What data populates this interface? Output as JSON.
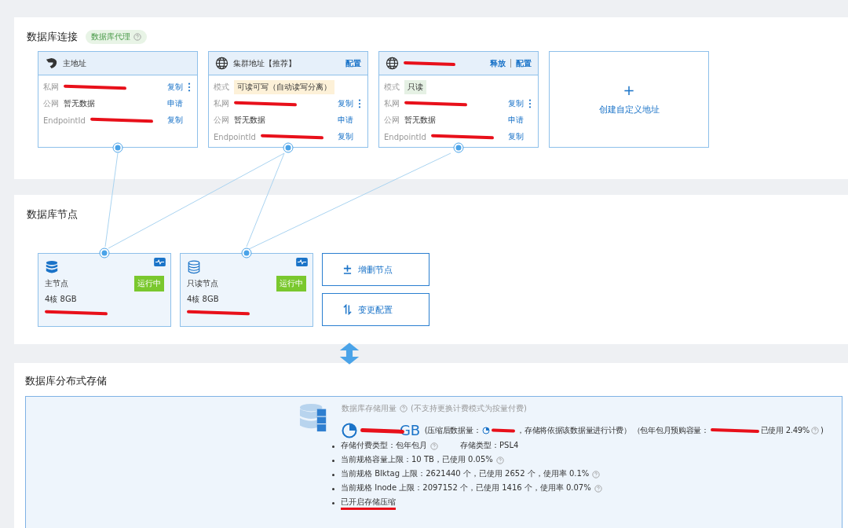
{
  "connection": {
    "title": "数据库连接",
    "tag": "数据库代理",
    "addresses": [
      {
        "kind": "named",
        "title": "主地址",
        "rows": [
          {
            "label": "私网",
            "kind": "redacted",
            "action": "复制",
            "more": true
          },
          {
            "label": "公网",
            "kind": "text",
            "value": "暂无数据",
            "action": "申请",
            "more": false
          },
          {
            "label": "EndpointId",
            "kind": "redacted",
            "action": "复制",
            "more": false
          }
        ]
      },
      {
        "kind": "named",
        "title": "集群地址【推荐】",
        "actions": [
          "配置"
        ],
        "rows": [
          {
            "label": "模式",
            "kind": "mode",
            "value": "可读可写（自动读写分离）",
            "color": "#fdf1d8",
            "more": false
          },
          {
            "label": "私网",
            "kind": "redacted",
            "action": "复制",
            "more": true
          },
          {
            "label": "公网",
            "kind": "text",
            "value": "暂无数据",
            "action": "申请",
            "more": false
          },
          {
            "label": "EndpointId",
            "kind": "redacted",
            "action": "复制",
            "more": false
          }
        ]
      },
      {
        "kind": "redacted",
        "actions": [
          "释放",
          "配置"
        ],
        "rows": [
          {
            "label": "模式",
            "kind": "mode",
            "value": "只读",
            "color": "#e5f1e4",
            "more": false
          },
          {
            "label": "私网",
            "kind": "redacted",
            "action": "复制",
            "more": true
          },
          {
            "label": "公网",
            "kind": "text",
            "value": "暂无数据",
            "action": "申请",
            "more": false
          },
          {
            "label": "EndpointId",
            "kind": "redacted",
            "action": "复制",
            "more": false
          }
        ]
      }
    ],
    "create": {
      "icon": "+",
      "label": "创建自定义地址"
    }
  },
  "nodes": {
    "title": "数据库节点",
    "items": [
      {
        "kind": "primary",
        "name": "主节点",
        "spec": "4核 8GB",
        "status": "运行中"
      },
      {
        "kind": "replica",
        "name": "只读节点",
        "spec": "4核 8GB",
        "status": "运行中"
      }
    ],
    "buttons": [
      {
        "kind": "add_remove",
        "label": "增删节点"
      },
      {
        "kind": "change",
        "label": "变更配置"
      }
    ]
  },
  "storage": {
    "title": "数据库分布式存储",
    "usage_label": "数据库存储用量",
    "usage_note": "(不支持更换计费模式为按量付费)",
    "amount_unit": "GB",
    "compressed_prefix": "(压缩后数据量：",
    "compressed_suffix": "，存储将依据该数据量进行计费）",
    "prepaid_prefix": "（包年包月预购容量：",
    "prepaid_used": "已使用 2.49%",
    "prepaid_close": ")",
    "bullets": [
      {
        "text": "存储付费类型：包年包月",
        "help": true,
        "extra": "存储类型：PSL4",
        "underlined": false
      },
      {
        "text": "当前规格容量上限：10 TB，已使用 0.05%",
        "help": true,
        "underlined": false
      },
      {
        "text": "当前规格 Blktag 上限：2621440 个，已使用 2652 个，使用率 0.1%",
        "help": true,
        "underlined": false
      },
      {
        "text": "当前规格 Inode 上限：2097152 个，已使用 1416 个，使用率 0.07%",
        "help": true,
        "underlined": false
      },
      {
        "text": "已开启存储压缩",
        "help": false,
        "underlined": true
      }
    ]
  }
}
